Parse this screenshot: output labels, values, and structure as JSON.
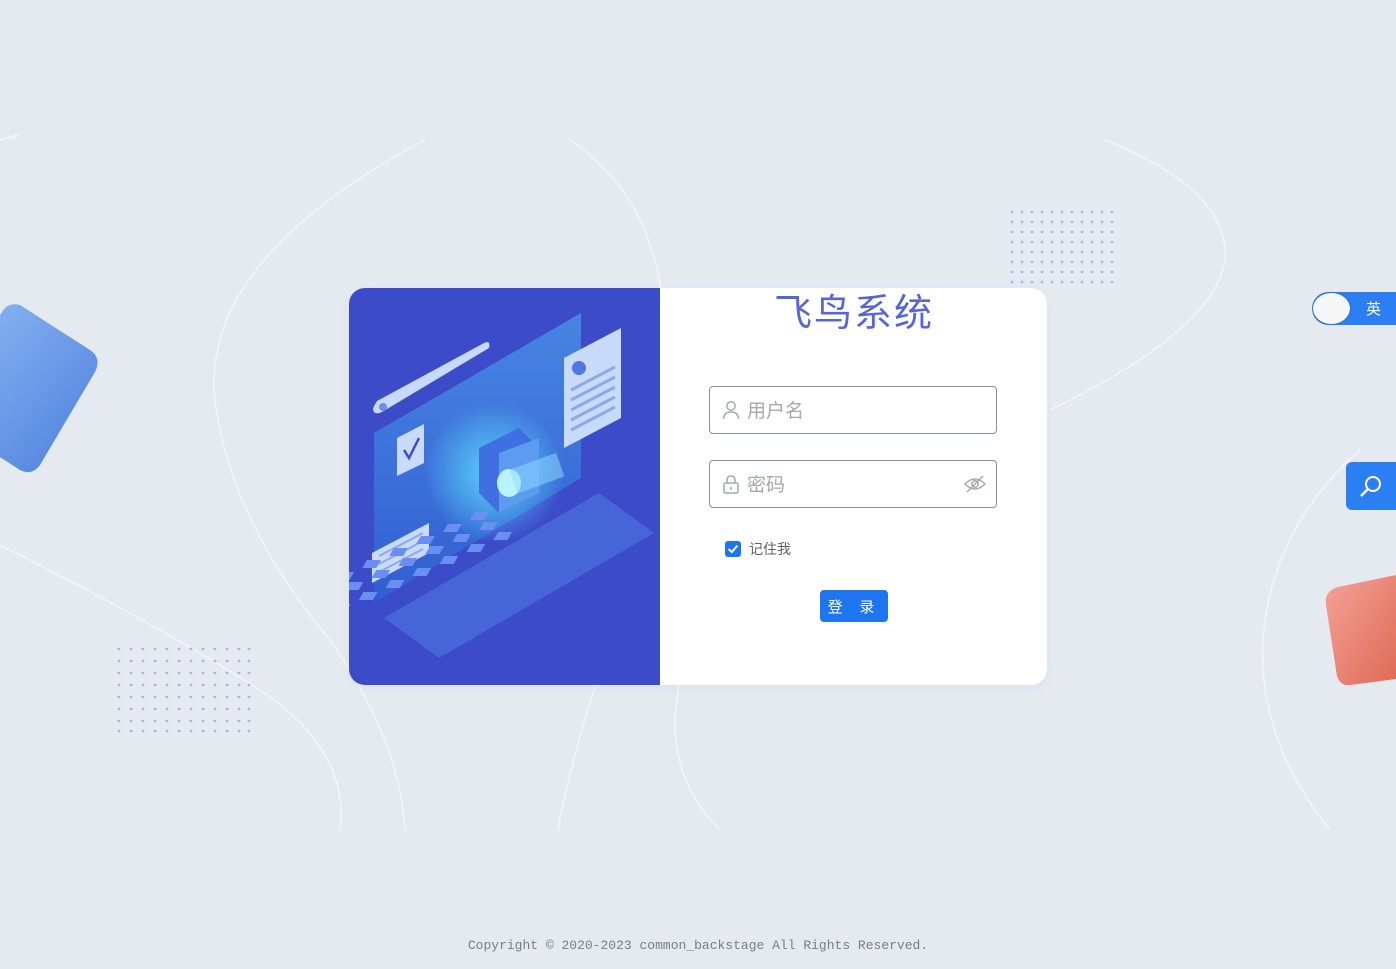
{
  "app": {
    "title": "飞鸟系统"
  },
  "login": {
    "username_placeholder": "用户名",
    "password_placeholder": "密码",
    "remember_label": "记住我",
    "remember_checked": true,
    "submit_label": "登 录"
  },
  "lang_toggle": {
    "label": "英"
  },
  "footer": {
    "copyright": "Copyright © 2020-2023 common_backstage All Rights Reserved."
  },
  "colors": {
    "background": "#e5eaf1",
    "brand": "#1f74f0",
    "title": "#5865d8",
    "illustration": "#3c4bc8"
  },
  "icons": {
    "username": "user-icon",
    "password": "lock-icon",
    "eye": "eye-off-icon",
    "search": "search-icon",
    "check": "check-icon"
  }
}
